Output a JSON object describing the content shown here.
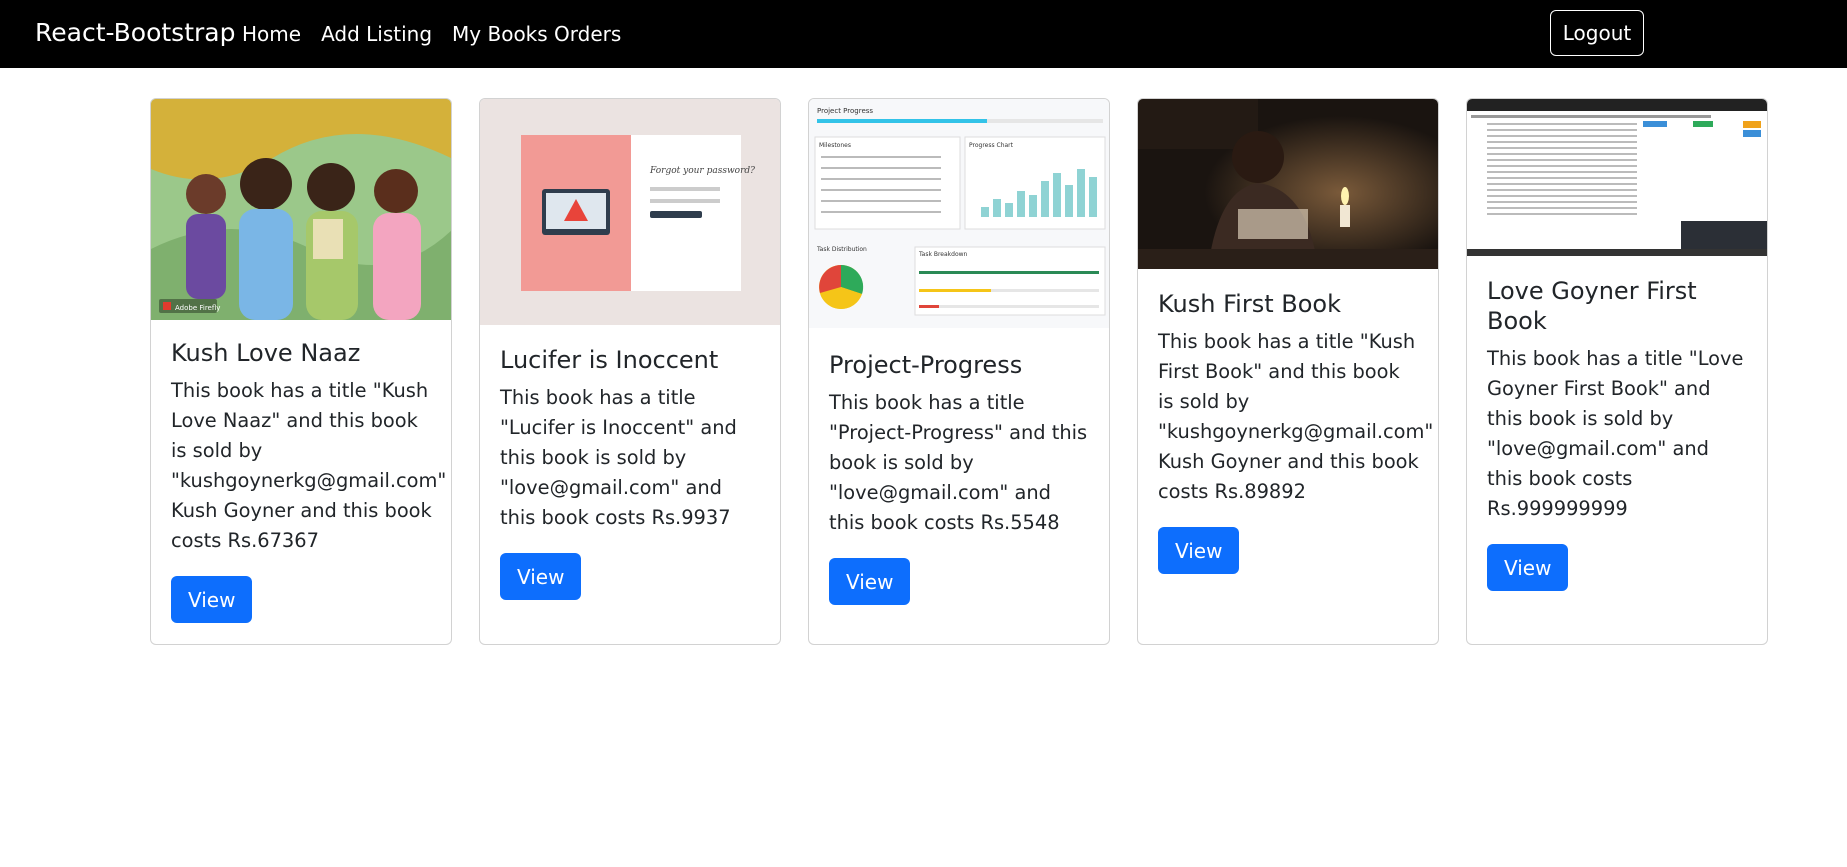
{
  "navbar": {
    "brand": "React-Bootstrap",
    "links": [
      "Home",
      "Add Listing",
      "My Books Orders"
    ],
    "logout_label": "Logout"
  },
  "cards": [
    {
      "title": "Kush Love Naaz",
      "text": "This book has a title \"Kush Love Naaz\" and this book is sold by \"kushgoynerkg@gmail.com\" Kush Goyner and this book costs Rs.67367",
      "button": "View",
      "image": "students-illustration",
      "image_badge": "Adobe Firefly"
    },
    {
      "title": "Lucifer is Inoccent",
      "text": "This book has a title \"Lucifer is Inoccent\" and this book is sold by \"love@gmail.com\" and this book costs Rs.9937",
      "button": "View",
      "image": "forgot-password-screenshot"
    },
    {
      "title": "Project-Progress",
      "text": "This book has a title \"Project-Progress\" and this book is sold by \"love@gmail.com\" and this book costs Rs.5548",
      "button": "View",
      "image": "project-progress-screenshot",
      "image_labels": {
        "progress": "Project Progress",
        "milestones": "Milestones",
        "chart": "Progress Chart",
        "distribution": "Task Distribution",
        "breakdown": "Task Breakdown"
      }
    },
    {
      "title": "Kush First Book",
      "text": "This book has a title \"Kush First Book\" and this book is sold by \"kushgoynerkg@gmail.com\" Kush Goyner and this book costs Rs.89892",
      "button": "View",
      "image": "candlelit-reading-photo"
    },
    {
      "title": "Love Goyner First Book",
      "text": "This book has a title \"Love Goyner First Book\" and this book is sold by \"love@gmail.com\" and this book costs Rs.999999999",
      "button": "View",
      "image": "table-screenshot"
    }
  ],
  "colors": {
    "navbar_bg": "#000000",
    "primary": "#0d6efd",
    "text": "#212529"
  }
}
